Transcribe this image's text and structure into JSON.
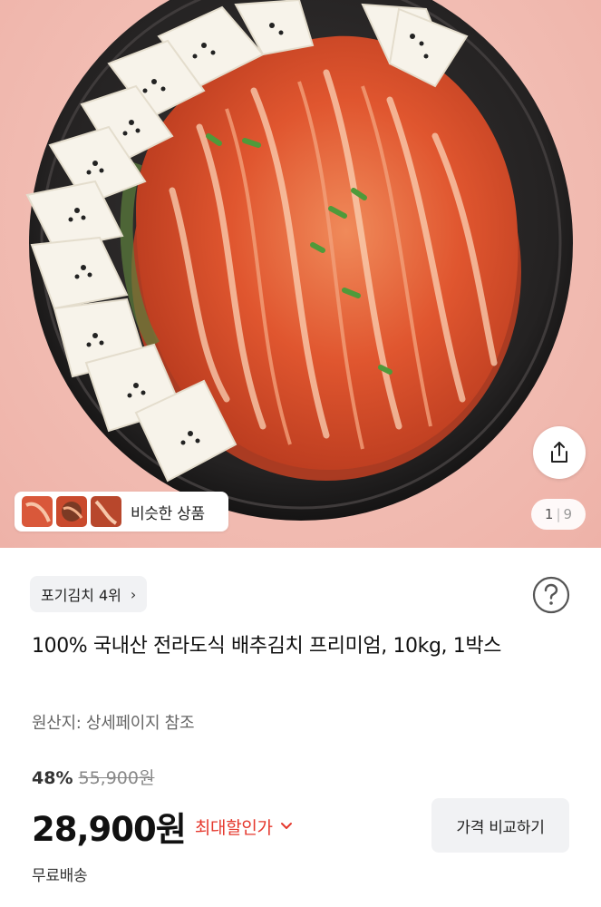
{
  "hero": {
    "similar_label": "비슷한 상품",
    "page_current": "1",
    "page_separator": "|",
    "page_total": "9",
    "share_icon": "share-icon"
  },
  "product": {
    "rank_label": "포기김치 4위",
    "rank_chevron": "›",
    "title": "100% 국내산 전라도식 배추김치 프리미엄, 10kg, 1박스",
    "origin": "원산지: 상세페이지 참조",
    "discount_rate": "48%",
    "original_price": "55,900원",
    "price": "28,900원",
    "max_discount_label": "최대할인가",
    "compare_button": "가격 비교하기",
    "shipping": "무료배송"
  },
  "colors": {
    "accent_red": "#e5382d",
    "chip_bg": "#f1f2f4",
    "hero_bg": "#f2bdb3"
  }
}
